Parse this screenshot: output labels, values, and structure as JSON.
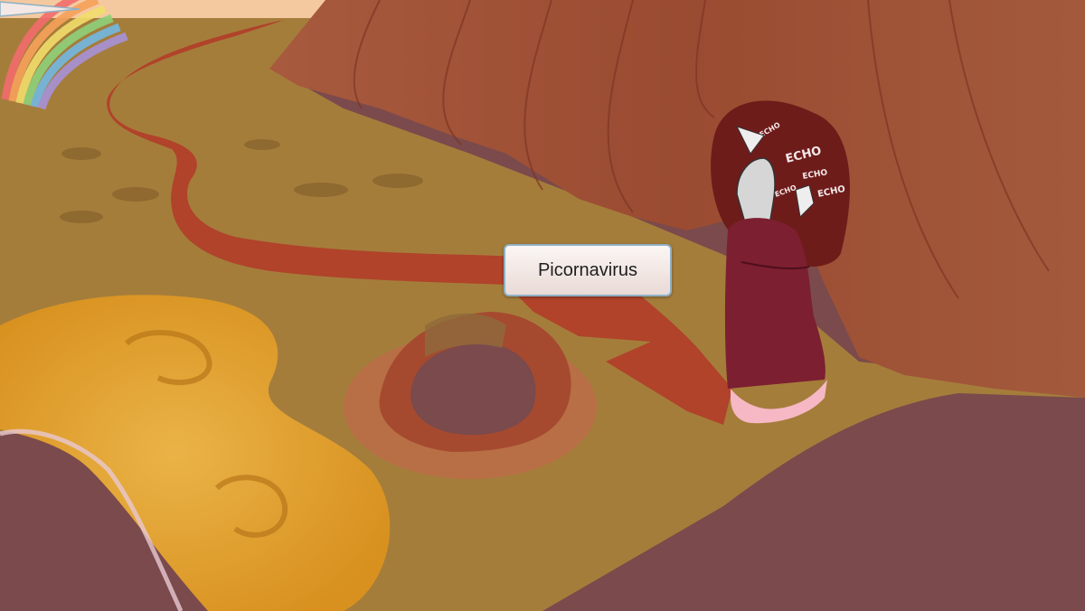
{
  "scene": {
    "callout": {
      "label": "Picornavirus"
    },
    "echo_labels": [
      "ECHO",
      "ECHO",
      "ECHO",
      "ECHO",
      "ECHO"
    ],
    "colors": {
      "ground": "#a57d3b",
      "road": "#b0432a",
      "cliff": "#9c4c32",
      "cave": "#6e1c1a",
      "honey": "#e1a02c",
      "purple_floor": "#7a4a4c",
      "character_dress": "#7c1f30",
      "character_frill": "#f6b8c4",
      "sky": "#f4c9a0"
    },
    "icons": [
      "rainbow",
      "cliff",
      "cave",
      "character",
      "crater",
      "road",
      "honey-pool"
    ]
  }
}
